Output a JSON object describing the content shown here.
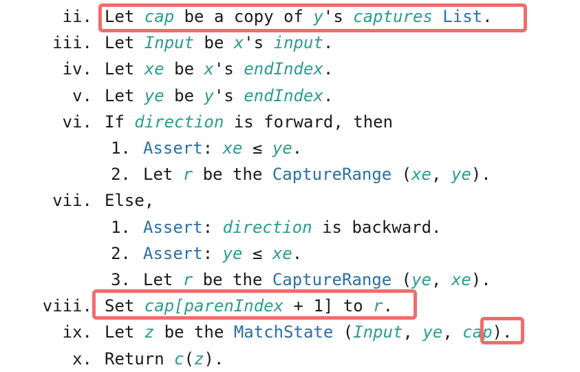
{
  "steps": [
    {
      "num": "ii.",
      "parts": [
        {
          "t": "Let "
        },
        {
          "t": "cap",
          "k": "var"
        },
        {
          "t": " be a copy of "
        },
        {
          "t": "y",
          "k": "var"
        },
        {
          "t": "'s "
        },
        {
          "t": "captures",
          "k": "var"
        },
        {
          "t": " "
        },
        {
          "t": "List",
          "k": "ref"
        },
        {
          "t": "."
        }
      ]
    },
    {
      "num": "iii.",
      "parts": [
        {
          "t": "Let "
        },
        {
          "t": "Input",
          "k": "var"
        },
        {
          "t": " be "
        },
        {
          "t": "x",
          "k": "var"
        },
        {
          "t": "'s "
        },
        {
          "t": "input",
          "k": "var"
        },
        {
          "t": "."
        }
      ]
    },
    {
      "num": "iv.",
      "parts": [
        {
          "t": "Let "
        },
        {
          "t": "xe",
          "k": "var"
        },
        {
          "t": " be "
        },
        {
          "t": "x",
          "k": "var"
        },
        {
          "t": "'s "
        },
        {
          "t": "endIndex",
          "k": "var"
        },
        {
          "t": "."
        }
      ]
    },
    {
      "num": "v.",
      "parts": [
        {
          "t": "Let "
        },
        {
          "t": "ye",
          "k": "var"
        },
        {
          "t": " be "
        },
        {
          "t": "y",
          "k": "var"
        },
        {
          "t": "'s "
        },
        {
          "t": "endIndex",
          "k": "var"
        },
        {
          "t": "."
        }
      ]
    },
    {
      "num": "vi.",
      "parts": [
        {
          "t": "If "
        },
        {
          "t": "direction",
          "k": "var"
        },
        {
          "t": " is forward, then"
        }
      ]
    },
    {
      "num": "1.",
      "sub": true,
      "parts": [
        {
          "t": "Assert",
          "k": "ref"
        },
        {
          "t": ": "
        },
        {
          "t": "xe",
          "k": "var"
        },
        {
          "t": " ≤ "
        },
        {
          "t": "ye",
          "k": "var"
        },
        {
          "t": "."
        }
      ]
    },
    {
      "num": "2.",
      "sub": true,
      "parts": [
        {
          "t": "Let "
        },
        {
          "t": "r",
          "k": "var"
        },
        {
          "t": " be the "
        },
        {
          "t": "CaptureRange",
          "k": "ref"
        },
        {
          "t": " ("
        },
        {
          "t": "xe",
          "k": "var"
        },
        {
          "t": ", "
        },
        {
          "t": "ye",
          "k": "var"
        },
        {
          "t": ")."
        }
      ]
    },
    {
      "num": "vii.",
      "parts": [
        {
          "t": "Else,"
        }
      ]
    },
    {
      "num": "1.",
      "sub": true,
      "parts": [
        {
          "t": "Assert",
          "k": "ref"
        },
        {
          "t": ": "
        },
        {
          "t": "direction",
          "k": "var"
        },
        {
          "t": " is backward."
        }
      ]
    },
    {
      "num": "2.",
      "sub": true,
      "parts": [
        {
          "t": "Assert",
          "k": "ref"
        },
        {
          "t": ": "
        },
        {
          "t": "ye",
          "k": "var"
        },
        {
          "t": " ≤ "
        },
        {
          "t": "xe",
          "k": "var"
        },
        {
          "t": "."
        }
      ]
    },
    {
      "num": "3.",
      "sub": true,
      "parts": [
        {
          "t": "Let "
        },
        {
          "t": "r",
          "k": "var"
        },
        {
          "t": " be the "
        },
        {
          "t": "CaptureRange",
          "k": "ref"
        },
        {
          "t": " ("
        },
        {
          "t": "ye",
          "k": "var"
        },
        {
          "t": ", "
        },
        {
          "t": "xe",
          "k": "var"
        },
        {
          "t": ")."
        }
      ]
    },
    {
      "num": "viii.",
      "parts": [
        {
          "t": "Set "
        },
        {
          "t": "cap",
          "k": "var"
        },
        {
          "t": "[",
          "k": "var"
        },
        {
          "t": "parenIndex",
          "k": "var"
        },
        {
          "t": " + 1] to "
        },
        {
          "t": "r",
          "k": "var"
        },
        {
          "t": "."
        }
      ]
    },
    {
      "num": "ix.",
      "parts": [
        {
          "t": "Let "
        },
        {
          "t": "z",
          "k": "var"
        },
        {
          "t": " be the "
        },
        {
          "t": "MatchState",
          "k": "ref"
        },
        {
          "t": " ("
        },
        {
          "t": "Input",
          "k": "var"
        },
        {
          "t": ", "
        },
        {
          "t": "ye",
          "k": "var"
        },
        {
          "t": ", "
        },
        {
          "t": "cap",
          "k": "var"
        },
        {
          "t": ")."
        }
      ]
    },
    {
      "num": "x.",
      "parts": [
        {
          "t": "Return "
        },
        {
          "t": "c",
          "k": "var"
        },
        {
          "t": "("
        },
        {
          "t": "z",
          "k": "var"
        },
        {
          "t": ")."
        }
      ]
    }
  ],
  "colors": {
    "text": "#1a1a1a",
    "variable": "#2a9d8f",
    "reference": "#2a6fa6",
    "highlight": "#f26b6b"
  }
}
